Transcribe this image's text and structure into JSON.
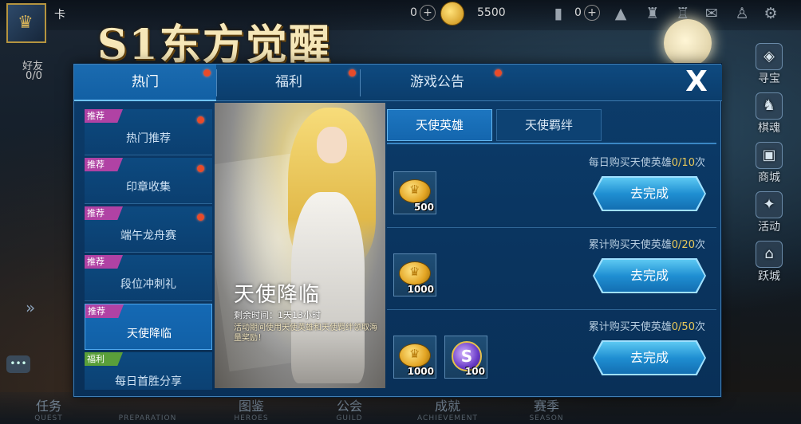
{
  "header": {
    "player_name": "卡",
    "friends_label": "好友",
    "friends_count": "0/0",
    "event_title": "S1东方觉醒",
    "currency_a": "0",
    "currency_coin": "5500",
    "currency_b": "0"
  },
  "right_menu": [
    "寻宝",
    "棋魂",
    "商城",
    "活动",
    "跃城"
  ],
  "bottom_nav": [
    {
      "cn": "任务",
      "en": "QUEST"
    },
    {
      "cn": "",
      "en": "PREPARATION"
    },
    {
      "cn": "图鉴",
      "en": "HEROES"
    },
    {
      "cn": "公会",
      "en": "GUILD"
    },
    {
      "cn": "成就",
      "en": "ACHIEVEMENT"
    },
    {
      "cn": "赛季",
      "en": "SEASON"
    }
  ],
  "modal": {
    "tabs": [
      {
        "label": "热门",
        "active": true
      },
      {
        "label": "福利",
        "active": false
      },
      {
        "label": "游戏公告",
        "active": false
      }
    ],
    "close_label": "X",
    "side_items": [
      {
        "tag": "推荐",
        "label": "热门推荐",
        "dot": true
      },
      {
        "tag": "推荐",
        "label": "印章收集",
        "dot": true
      },
      {
        "tag": "推荐",
        "label": "端午龙舟赛",
        "dot": true
      },
      {
        "tag": "推荐",
        "label": "段位冲刺礼",
        "dot": false
      },
      {
        "tag": "推荐",
        "label": "天使降临",
        "dot": false,
        "active": true
      },
      {
        "tag": "福利",
        "label": "每日首胜分享",
        "dot": false
      }
    ],
    "banner": {
      "title": "天使降临",
      "time": "剩余时间：1天13小时",
      "desc": "活动期间使用天使英雄和天使羁绊领取海量奖励！"
    },
    "sub_tabs": [
      {
        "label": "天使英雄",
        "active": true
      },
      {
        "label": "天使羁绊",
        "active": false
      }
    ],
    "tasks": [
      {
        "cond_prefix": "每日购买天使英雄",
        "cond_progress": "0/10",
        "cond_suffix": "次",
        "rewards": [
          {
            "type": "coin",
            "qty": "500"
          }
        ],
        "button": "去完成"
      },
      {
        "cond_prefix": "累计购买天使英雄",
        "cond_progress": "0/20",
        "cond_suffix": "次",
        "rewards": [
          {
            "type": "coin",
            "qty": "1000"
          }
        ],
        "button": "去完成"
      },
      {
        "cond_prefix": "累计购买天使英雄",
        "cond_progress": "0/50",
        "cond_suffix": "次",
        "rewards": [
          {
            "type": "coin",
            "qty": "1000"
          },
          {
            "type": "symbol",
            "qty": "100",
            "glyph": "S"
          }
        ],
        "button": "去完成"
      }
    ]
  }
}
